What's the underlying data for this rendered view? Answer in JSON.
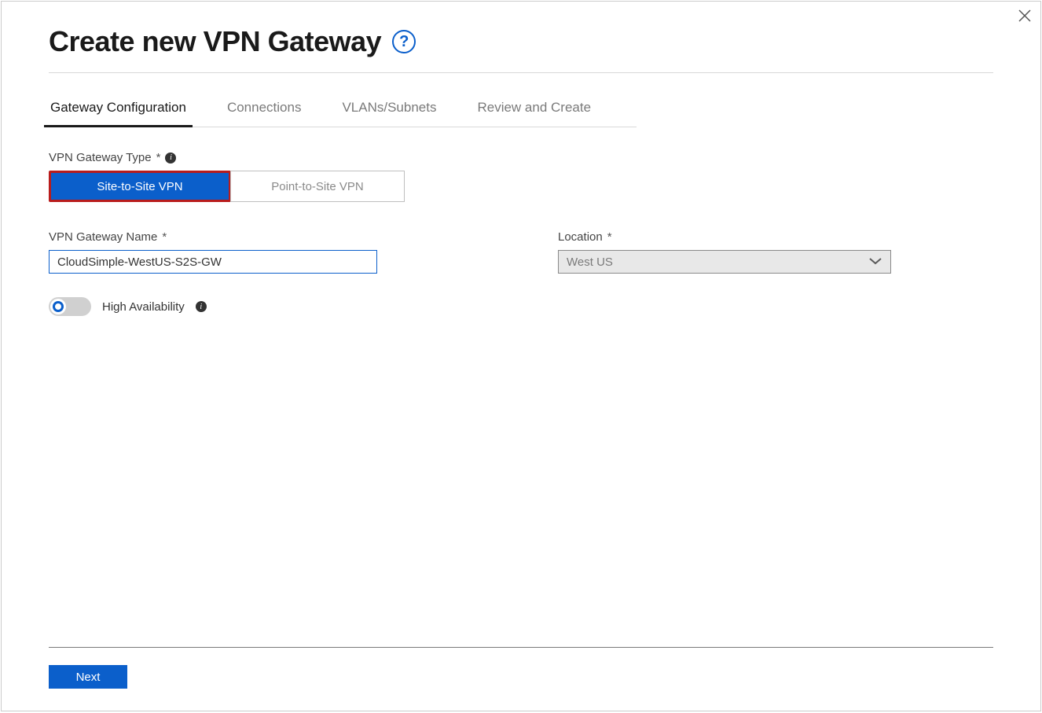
{
  "title": "Create new VPN Gateway",
  "tabs": [
    {
      "label": "Gateway Configuration"
    },
    {
      "label": "Connections"
    },
    {
      "label": "VLANs/Subnets"
    },
    {
      "label": "Review and Create"
    }
  ],
  "activeTabIndex": 0,
  "fields": {
    "type": {
      "label": "VPN Gateway Type",
      "required": "*",
      "options": {
        "siteToSite": "Site-to-Site VPN",
        "pointToSite": "Point-to-Site VPN"
      },
      "selected": "siteToSite"
    },
    "name": {
      "label": "VPN Gateway Name",
      "required": "*",
      "value": "CloudSimple-WestUS-S2S-GW"
    },
    "location": {
      "label": "Location",
      "required": "*",
      "value": "West US"
    },
    "highAvailability": {
      "label": "High Availability",
      "value": false
    }
  },
  "buttons": {
    "next": "Next",
    "help": "?"
  }
}
